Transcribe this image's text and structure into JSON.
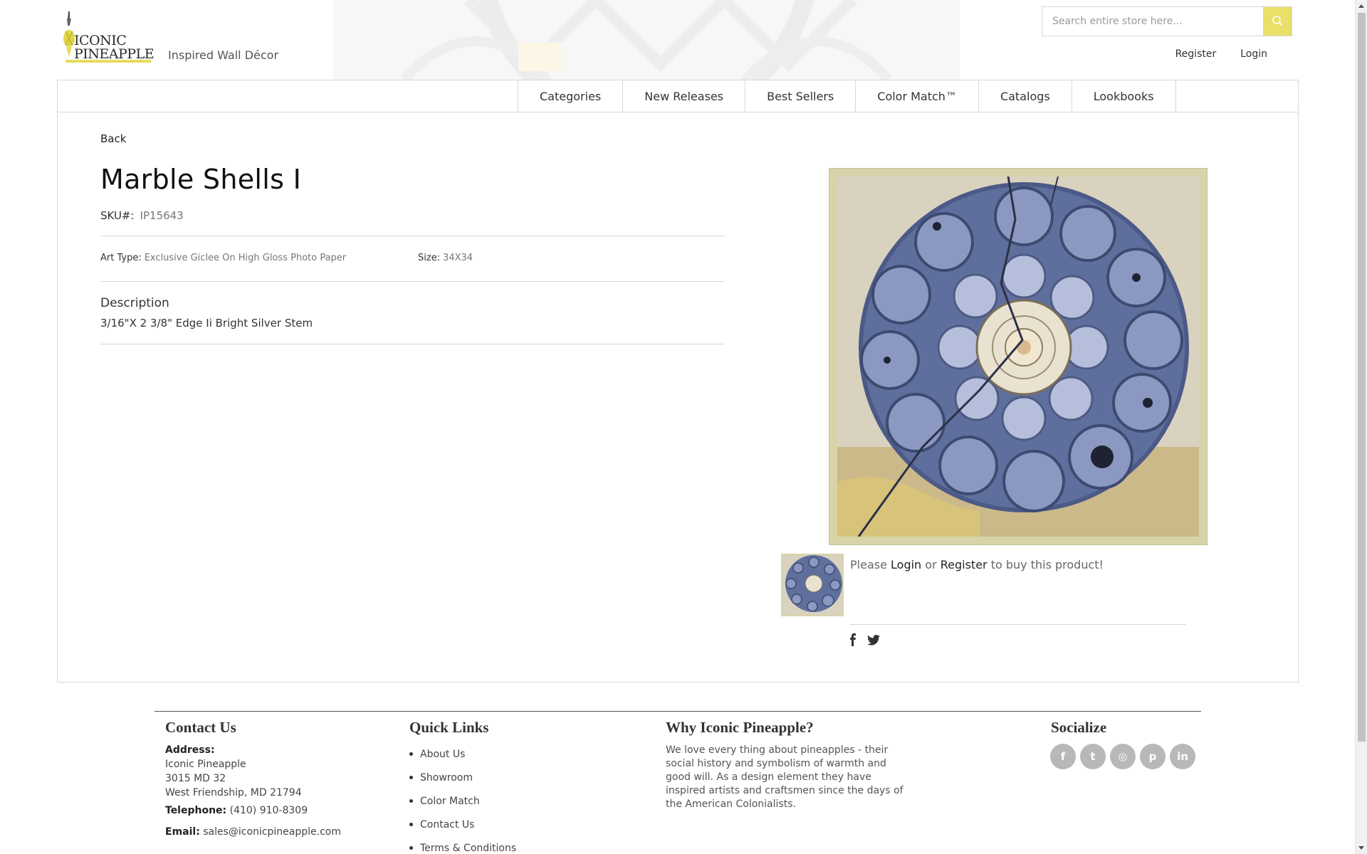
{
  "header": {
    "brand_line1": "ICONIC",
    "brand_line2": "PINEAPPLE",
    "tagline": "Inspired Wall Décor",
    "search_placeholder": "Search entire store here...",
    "register_label": "Register",
    "login_label": "Login"
  },
  "nav": {
    "items": [
      {
        "label": "Categories"
      },
      {
        "label": "New Releases"
      },
      {
        "label": "Best Sellers"
      },
      {
        "label": "Color Match™"
      },
      {
        "label": "Catalogs"
      },
      {
        "label": "Lookbooks"
      }
    ]
  },
  "product": {
    "back_label": "Back",
    "title": "Marble Shells I",
    "sku_label": "SKU#:",
    "sku_value": "IP15643",
    "art_type_label": "Art Type:",
    "art_type_value": "Exclusive Giclee On High Gloss Photo Paper",
    "size_label": "Size:",
    "size_value": "34X34",
    "description_title": "Description",
    "description_text": "3/16\"X 2 3/8\" Edge Ii Bright Silver Stem",
    "buy_prefix": "Please",
    "buy_login": "Login",
    "buy_or": "or",
    "buy_register": "Register",
    "buy_suffix": "to buy this product!"
  },
  "share": {
    "icons": [
      "facebook-icon",
      "twitter-icon"
    ]
  },
  "footer": {
    "contact_title": "Contact Us",
    "address_label": "Address:",
    "address_line1": "Iconic Pineapple",
    "address_line2": "3015 MD 32",
    "address_line3": "West Friendship, MD 21794",
    "telephone_label": "Telephone:",
    "telephone_value": "(410) 910-8309",
    "email_label": "Email:",
    "email_value": "sales@iconicpineapple.com",
    "quick_links_title": "Quick Links",
    "quick_links": [
      {
        "label": "About Us"
      },
      {
        "label": "Showroom"
      },
      {
        "label": "Color Match"
      },
      {
        "label": "Contact Us"
      },
      {
        "label": "Terms & Conditions"
      }
    ],
    "why_title": "Why Iconic Pineapple?",
    "why_text": "We love every thing about pineapples - their social history and symbolism of warmth and good will. As a design element they have inspired artists and craftsmen since the days of the American Colonialists.",
    "socialize_title": "Socialize",
    "social_icons": [
      {
        "name": "facebook-icon",
        "glyph": "f"
      },
      {
        "name": "twitter-icon",
        "glyph": "t"
      },
      {
        "name": "instagram-icon",
        "glyph": "◎"
      },
      {
        "name": "pinterest-icon",
        "glyph": "p"
      },
      {
        "name": "linkedin-icon",
        "glyph": "in"
      }
    ]
  },
  "colors": {
    "accent_yellow": "#e9e06a",
    "frame": "#d8d3a8"
  }
}
